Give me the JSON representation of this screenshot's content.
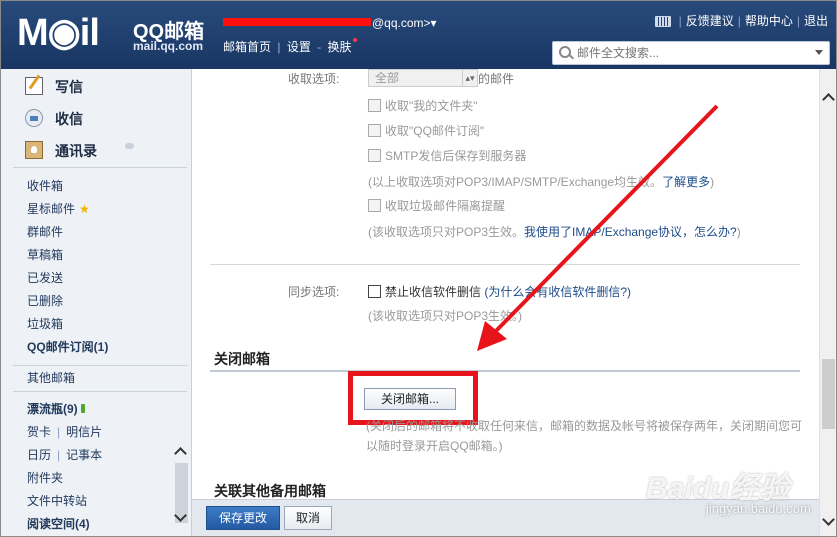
{
  "header": {
    "logo_text": "M◉il",
    "logo_title": "QQ邮箱",
    "logo_domain": "mail.qq.com",
    "user_suffix": "@qq.com>",
    "user_caret": "▾",
    "nav": [
      "邮箱首页",
      "设置",
      "换肤"
    ],
    "nav_seps": [
      "|",
      "-"
    ],
    "top_links": [
      "反馈建议",
      "帮助中心",
      "退出"
    ],
    "search_placeholder": "邮件全文搜索..."
  },
  "sidebar": {
    "primary": [
      {
        "label": "写信",
        "icon": "compose-icon"
      },
      {
        "label": "收信",
        "icon": "inbox-icon"
      },
      {
        "label": "通讯录",
        "icon": "contacts-icon"
      }
    ],
    "folders": [
      "收件箱",
      "星标邮件",
      "群邮件",
      "草稿箱",
      "已发送",
      "已删除",
      "垃圾箱",
      "QQ邮件订阅(1)"
    ],
    "other_mailbox": "其他邮箱",
    "apps": {
      "drift": "漂流瓶(9)",
      "card": "贺卡",
      "postcard": "明信片",
      "calendar": "日历",
      "notepad": "记事本",
      "attachments": "附件夹",
      "file_transfer": "文件中转站",
      "reading": "阅读空间(4)"
    }
  },
  "settings": {
    "receive_label": "收取选项:",
    "receive_select": "全部",
    "receive_select_suffix": "的邮件",
    "options": [
      "收取\"我的文件夹\"",
      "收取\"QQ邮件订阅\"",
      "SMTP发信后保存到服务器"
    ],
    "note1": "(以上收取选项对POP3/IMAP/SMTP/Exchange均生效。",
    "note1_link": "了解更多",
    "note1_end": ")",
    "spam_option": "收取垃圾邮件隔离提醒",
    "note2": "(该收取选项只对POP3生效。",
    "note2_link": "我使用了IMAP/Exchange协议，怎么办?",
    "note2_end": ")",
    "sync_label": "同步选项:",
    "sync_option": "禁止收信软件删信",
    "sync_link": "(为什么会有收信软件删信?)",
    "note3": "(该收取选项只对POP3生效。)"
  },
  "close_section": {
    "title": "关闭邮箱",
    "button": "关闭邮箱...",
    "note": "(关闭后的邮箱将不收取任何来信，邮箱的数据及帐号将被保存两年，关闭期间您可以随时登录开启QQ邮箱。)"
  },
  "backup_section": {
    "title": "关联其他备用邮箱"
  },
  "footer": {
    "save": "保存更改",
    "cancel": "取消"
  },
  "watermark": {
    "brand": "Baidu经验",
    "url": "jingyan.baidu.com"
  },
  "colors": {
    "header": "#1d3d6b",
    "annotation_red": "#e8141b",
    "save_button": "#2f6bb8"
  }
}
